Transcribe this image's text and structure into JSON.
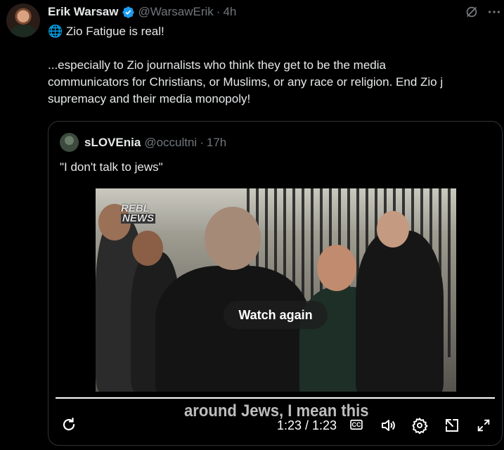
{
  "tweet": {
    "author_name": "Erik Warsaw",
    "handle": "@WarsawErik",
    "separator": "·",
    "time": "4h",
    "lines": [
      "🌐 Zio Fatigue is real!",
      "",
      "...especially to Zio journalists who think they get to be the media",
      "communicators for Christians, or Muslims, or any race or religion. End Zio j",
      "supremacy and their media monopoly!"
    ]
  },
  "icons": {
    "verified": "verified-badge-icon",
    "grok": "grok-icon",
    "more": "more-icon",
    "replay": "replay-icon",
    "cc": "closed-captions-icon",
    "volume": "volume-icon",
    "settings": "settings-icon",
    "popout": "picture-in-picture-icon",
    "fullscreen": "fullscreen-icon"
  },
  "quote": {
    "author_name": "sLOVEnia",
    "handle": "@occultni",
    "separator": "·",
    "time": "17h",
    "text": "\"I don't talk to jews\""
  },
  "video": {
    "watermark_line1": "REBL",
    "watermark_line2": "NEWS",
    "overlay_button": "Watch again",
    "caption": "around Jews, I mean this",
    "time_readout": "1:23 / 1:23",
    "progress_fraction": 1.0,
    "cc_label": "CC"
  },
  "colors": {
    "background": "#000000",
    "text": "#e7e9ea",
    "muted": "#71767b",
    "verified": "#1d9bf0",
    "border": "#2f3336"
  }
}
